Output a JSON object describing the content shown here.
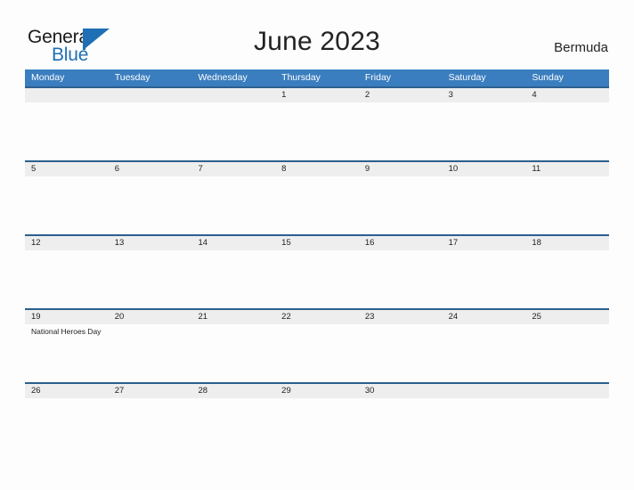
{
  "brand": {
    "word_one": "General",
    "word_two": "Blue",
    "flag_icon": "blue-flag-triangle",
    "accent_color": "#1f6fb5"
  },
  "header": {
    "title": "June 2023",
    "country": "Bermuda"
  },
  "calendar": {
    "header_bg": "#3a7ebf",
    "row_divider_color": "#2c5f8e",
    "date_stripe_color": "#eeeeee",
    "weekdays": [
      "Monday",
      "Tuesday",
      "Wednesday",
      "Thursday",
      "Friday",
      "Saturday",
      "Sunday"
    ],
    "weeks": [
      [
        {
          "date": ""
        },
        {
          "date": ""
        },
        {
          "date": ""
        },
        {
          "date": "1"
        },
        {
          "date": "2"
        },
        {
          "date": "3"
        },
        {
          "date": "4"
        }
      ],
      [
        {
          "date": "5"
        },
        {
          "date": "6"
        },
        {
          "date": "7"
        },
        {
          "date": "8"
        },
        {
          "date": "9"
        },
        {
          "date": "10"
        },
        {
          "date": "11"
        }
      ],
      [
        {
          "date": "12"
        },
        {
          "date": "13"
        },
        {
          "date": "14"
        },
        {
          "date": "15"
        },
        {
          "date": "16"
        },
        {
          "date": "17"
        },
        {
          "date": "18"
        }
      ],
      [
        {
          "date": "19",
          "event": "National Heroes Day"
        },
        {
          "date": "20"
        },
        {
          "date": "21"
        },
        {
          "date": "22"
        },
        {
          "date": "23"
        },
        {
          "date": "24"
        },
        {
          "date": "25"
        }
      ],
      [
        {
          "date": "26"
        },
        {
          "date": "27"
        },
        {
          "date": "28"
        },
        {
          "date": "29"
        },
        {
          "date": "30"
        },
        {
          "date": ""
        },
        {
          "date": ""
        }
      ]
    ]
  }
}
